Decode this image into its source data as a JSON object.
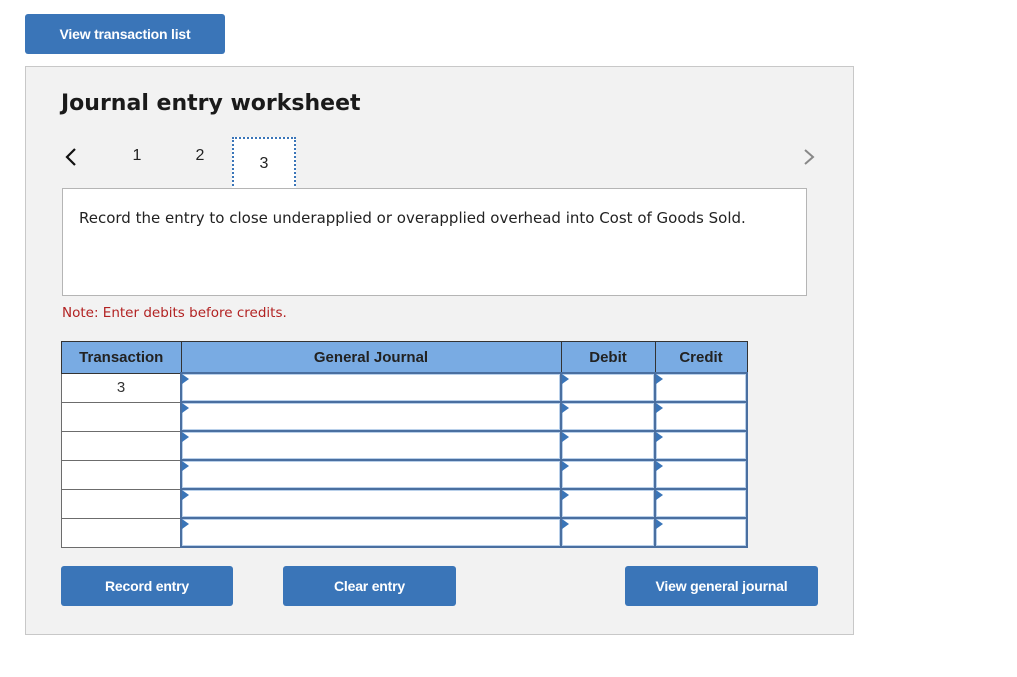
{
  "top_button": {
    "label": "View transaction list"
  },
  "worksheet": {
    "title": "Journal entry worksheet",
    "steps": [
      "1",
      "2",
      "3"
    ],
    "active_step": "3",
    "instruction": "Record the entry to close underapplied or overapplied overhead into Cost of Goods Sold.",
    "note": "Note: Enter debits before credits.",
    "table": {
      "headers": [
        "Transaction",
        "General Journal",
        "Debit",
        "Credit"
      ],
      "rows": [
        {
          "transaction": "3",
          "account": "",
          "debit": "",
          "credit": ""
        },
        {
          "transaction": "",
          "account": "",
          "debit": "",
          "credit": ""
        },
        {
          "transaction": "",
          "account": "",
          "debit": "",
          "credit": ""
        },
        {
          "transaction": "",
          "account": "",
          "debit": "",
          "credit": ""
        },
        {
          "transaction": "",
          "account": "",
          "debit": "",
          "credit": ""
        },
        {
          "transaction": "",
          "account": "",
          "debit": "",
          "credit": ""
        }
      ]
    },
    "buttons": {
      "record": "Record entry",
      "clear": "Clear entry",
      "view_general_journal": "View general journal"
    }
  },
  "colors": {
    "accent": "#3a75b8",
    "header_bg": "#79abe3",
    "note": "#b22222",
    "panel_bg": "#f2f2f2"
  }
}
